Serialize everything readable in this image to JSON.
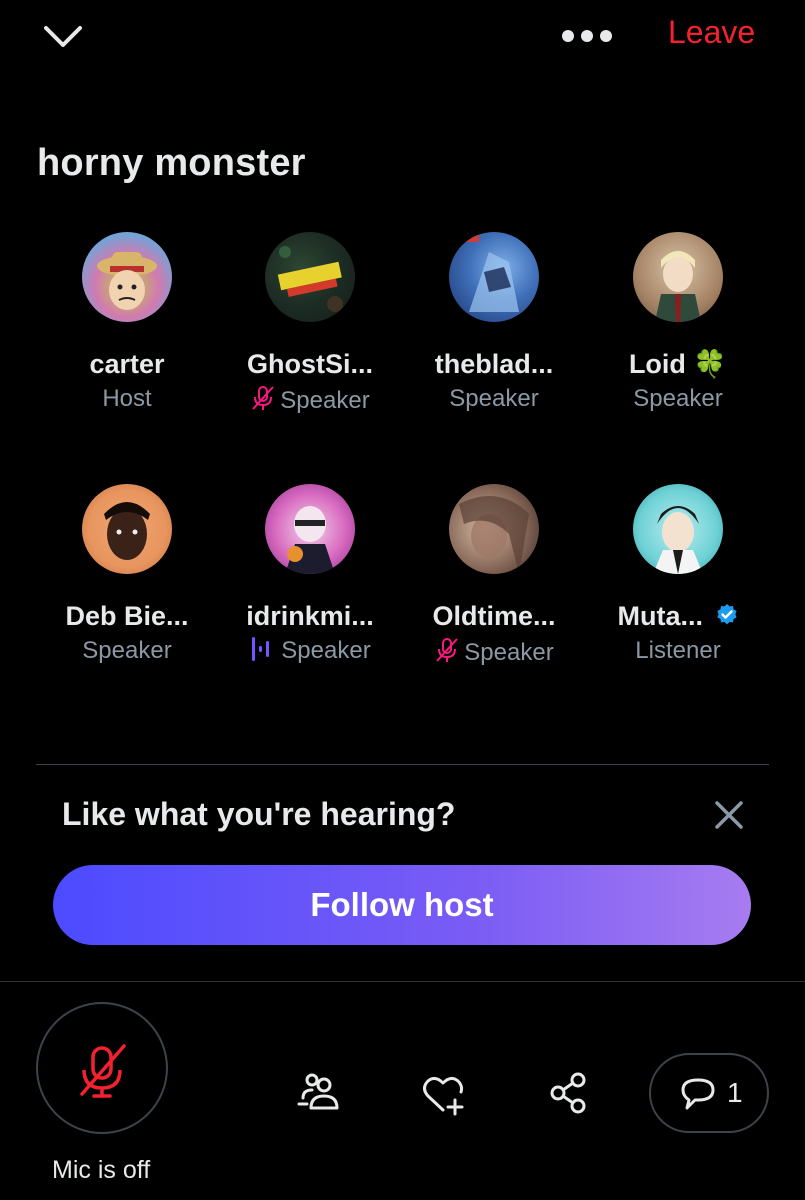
{
  "header": {
    "leave_label": "Leave",
    "chevron_icon": "chevron-down-icon",
    "more_icon": "more-options-icon"
  },
  "room": {
    "title": "horny monster"
  },
  "participants": [
    {
      "name": "carter",
      "role": "Host",
      "status_icon": ""
    },
    {
      "name": "GhostSi...",
      "role": "Speaker",
      "status_icon": "mic-muted-icon"
    },
    {
      "name": "theblad...",
      "role": "Speaker",
      "status_icon": ""
    },
    {
      "name": "Loid 🍀",
      "role": "Speaker",
      "status_icon": ""
    },
    {
      "name": "Deb Bie...",
      "role": "Speaker",
      "status_icon": ""
    },
    {
      "name": "idrinkmi...",
      "role": "Speaker",
      "status_icon": "speaking-icon"
    },
    {
      "name": "Oldtime...",
      "role": "Speaker",
      "status_icon": "mic-muted-icon"
    },
    {
      "name": "Muta...",
      "role": "Listener",
      "status_icon": "",
      "verified": true
    }
  ],
  "follow_prompt": {
    "text": "Like what you're hearing?",
    "button_label": "Follow host"
  },
  "bottom_bar": {
    "mic_label": "Mic is off",
    "comment_count": "1"
  },
  "colors": {
    "accent_red": "#f4212e",
    "muted_pink": "#f91880",
    "speaking_purple": "#7856ff",
    "verified_blue": "#1d9bf0",
    "secondary_text": "#8b98a5"
  }
}
